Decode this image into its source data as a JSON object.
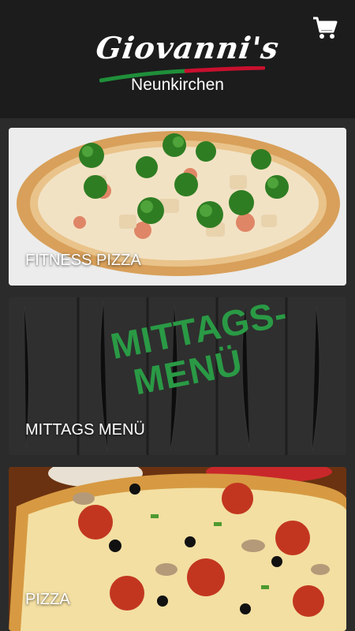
{
  "header": {
    "brand": "Giovanni's",
    "city": "Neunkirchen",
    "cart_icon": "cart-icon"
  },
  "categories": [
    {
      "label": "FITNESS PIZZA"
    },
    {
      "label": "MITTAGS MENÜ",
      "overlay_line1": "MITTAGS-",
      "overlay_line2": "MENÜ"
    },
    {
      "label": "PIZZA"
    }
  ],
  "colors": {
    "header_bg": "#1c1c1c",
    "page_bg": "#2b2b2b",
    "accent_green": "#1f8f3a",
    "accent_red": "#c8102e"
  }
}
